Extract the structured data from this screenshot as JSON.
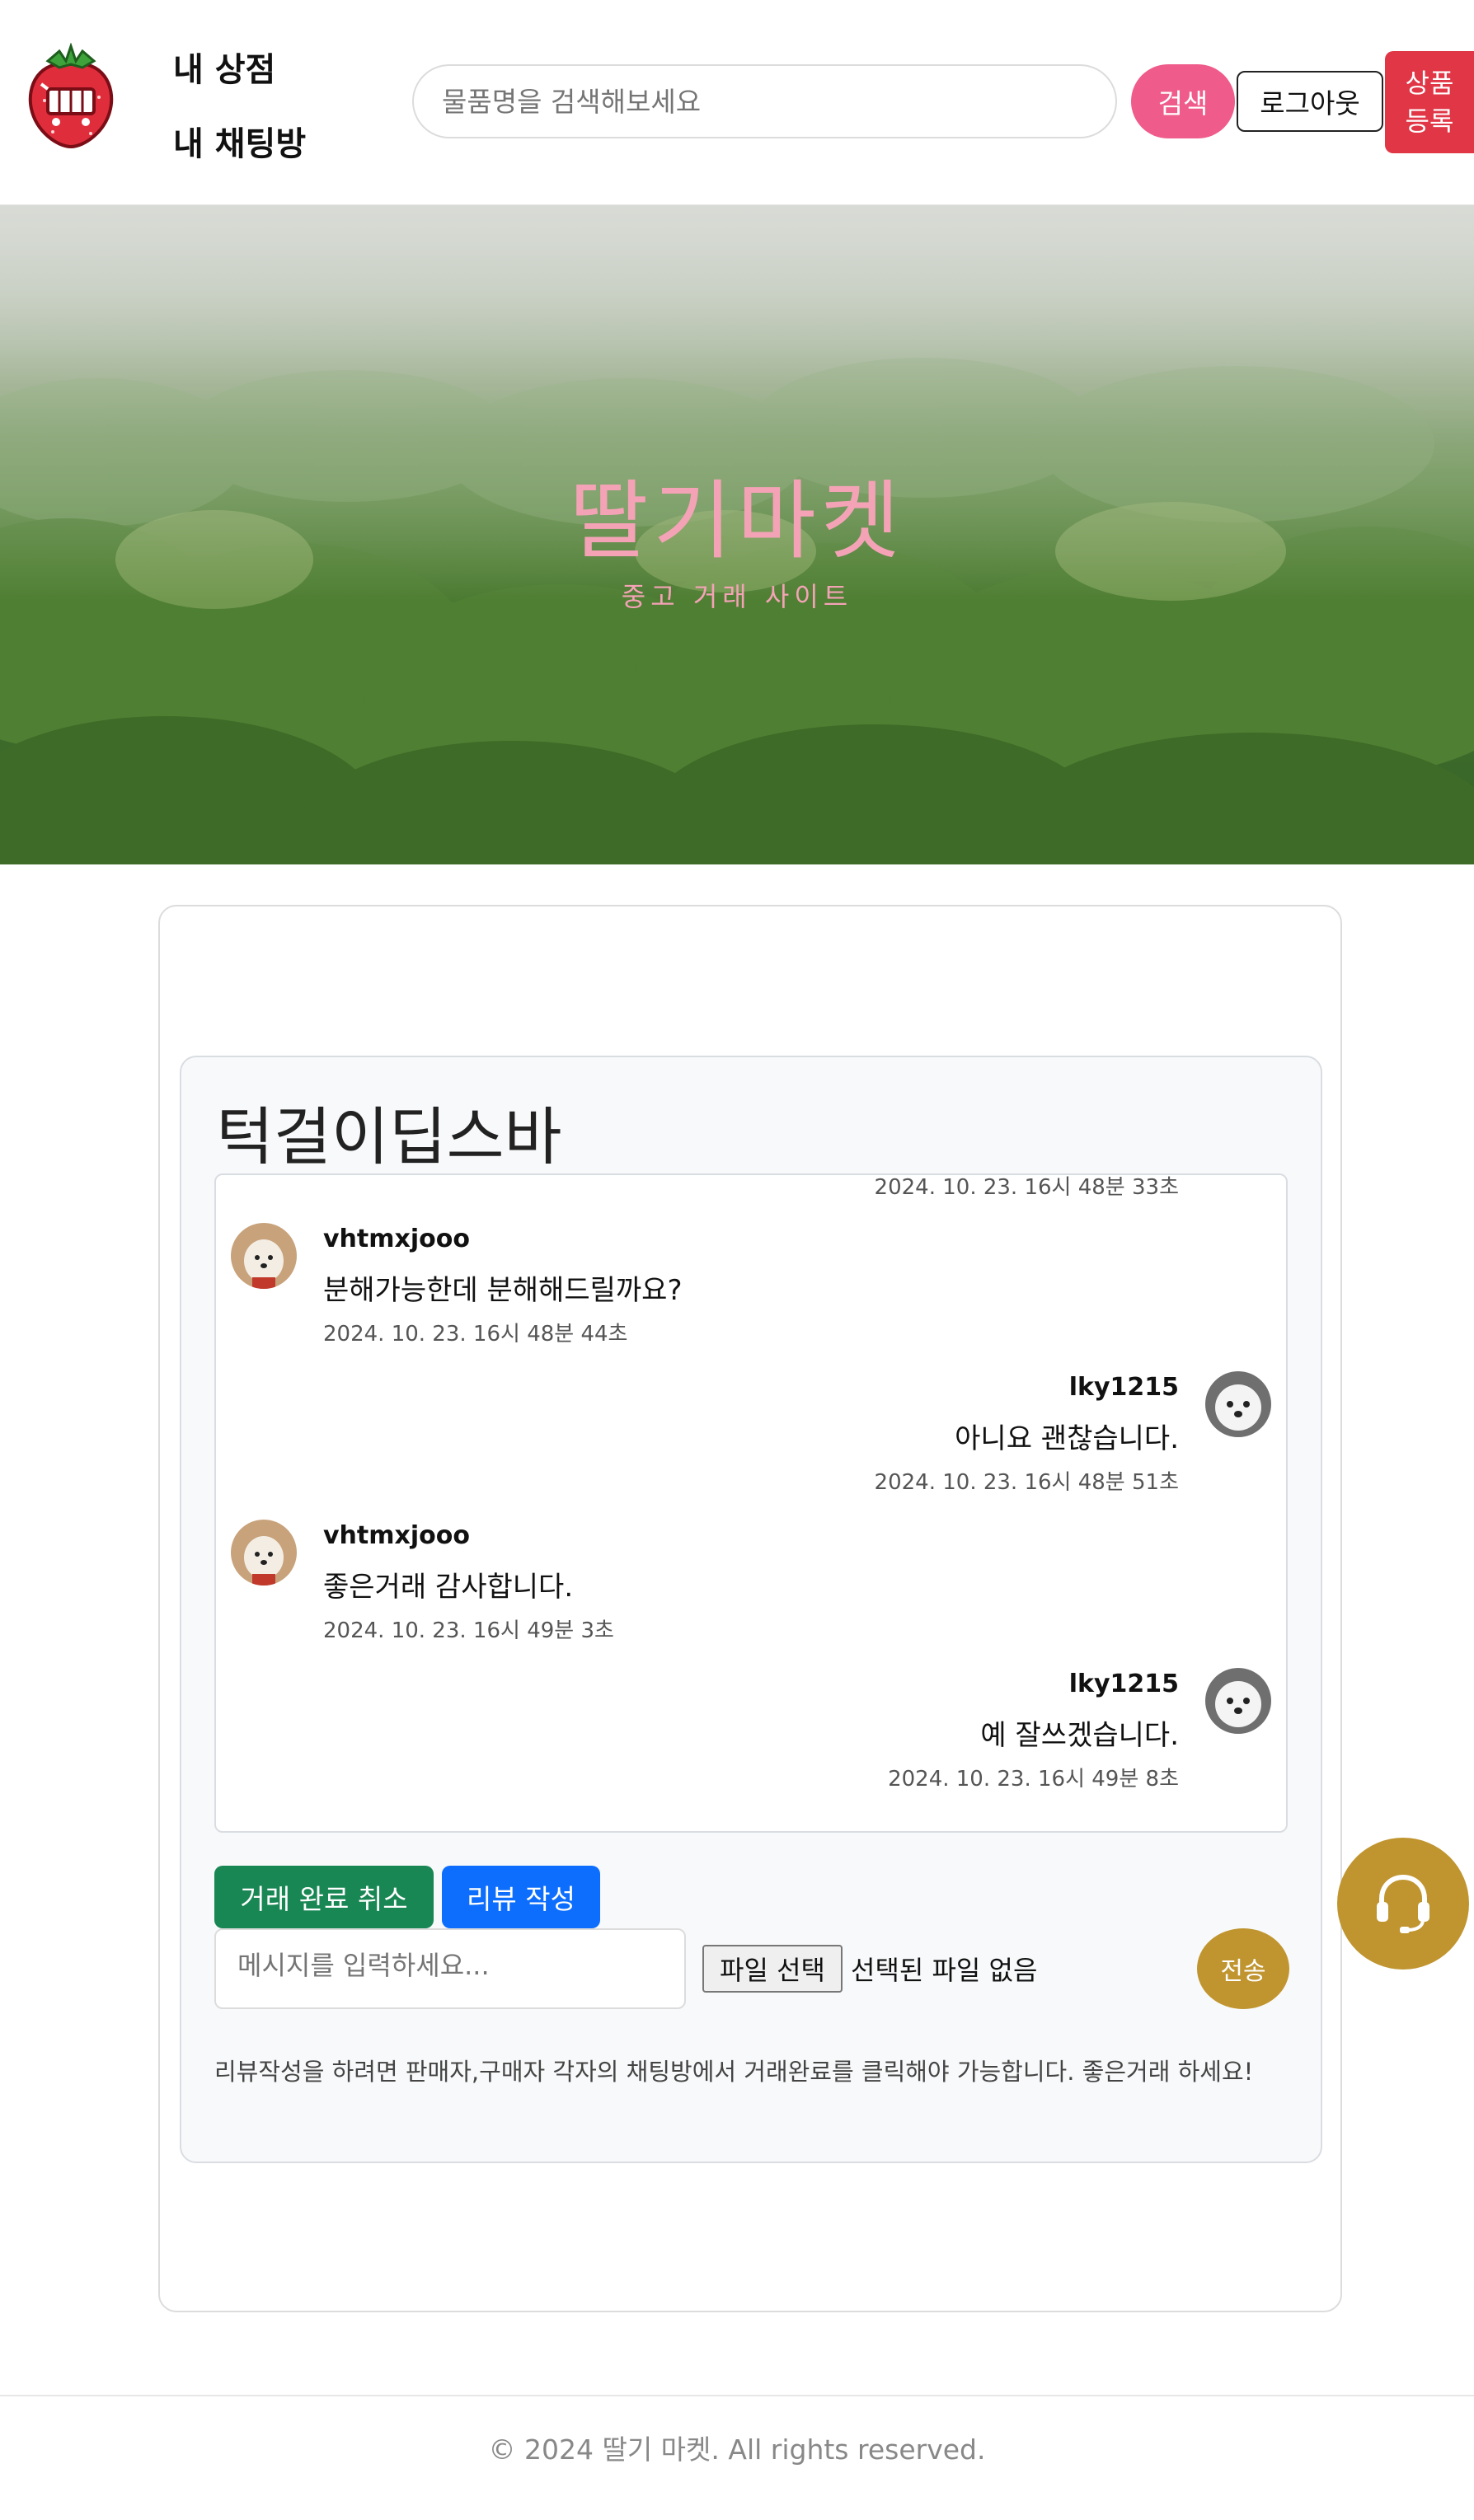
{
  "header": {
    "logo_icon": "strawberry-cart-logo-icon",
    "nav": {
      "my_store": "내 상점",
      "my_chats": "내 채팅방"
    },
    "search": {
      "placeholder": "물품명을 검색해보세요",
      "button": "검색"
    },
    "logout": "로그아웃",
    "register": {
      "line1": "상품",
      "line2": "등록"
    },
    "colors": {
      "search_button": "#ef5b8a",
      "register_button": "#e03646"
    }
  },
  "hero": {
    "title": "딸기마켓",
    "subtitle": "중고 거래 사이트"
  },
  "chat": {
    "room_title": "턱걸이딥스바",
    "messages": [
      {
        "side": "right",
        "user": "",
        "text": "",
        "time": "2024. 10. 23. 16시 48분 33초"
      },
      {
        "side": "left",
        "user": "vhtmxjooo",
        "text": "분해가능한데 분해해드릴까요?",
        "time": "2024. 10. 23. 16시 48분 44초"
      },
      {
        "side": "right",
        "user": "lky1215",
        "text": "아니요 괜찮습니다.",
        "time": "2024. 10. 23. 16시 48분 51초"
      },
      {
        "side": "left",
        "user": "vhtmxjooo",
        "text": "좋은거래 감사합니다.",
        "time": "2024. 10. 23. 16시 49분 3초"
      },
      {
        "side": "right",
        "user": "lky1215",
        "text": "예 잘쓰겠습니다.",
        "time": "2024. 10. 23. 16시 49분 8초"
      }
    ],
    "actions": {
      "cancel_done": "거래 완료 취소",
      "write_review": "리뷰 작성"
    },
    "input": {
      "placeholder": "메시지를 입력하세요...",
      "file_button": "파일 선택",
      "file_status": "선택된 파일 없음",
      "send": "전송"
    },
    "notice": "리뷰작성을 하려면 판매자,구매자 각자의 채팅방에서 거래완료를 클릭해야 가능합니다. 좋은거래 하세요!",
    "colors": {
      "done_button": "#198754",
      "review_button": "#0d6efd",
      "send_button": "#c09530"
    }
  },
  "support": {
    "icon": "headset-icon"
  },
  "footer": {
    "text": "© 2024 딸기 마켓. All rights reserved."
  }
}
